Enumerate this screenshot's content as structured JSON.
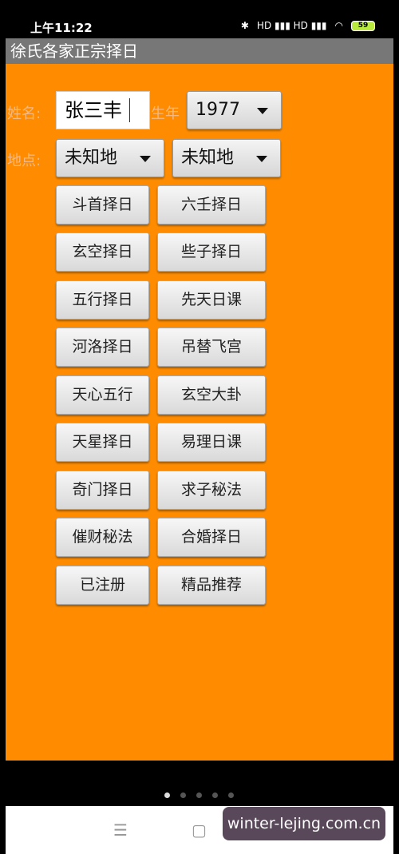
{
  "status_bar": {
    "time": "上午11:22",
    "signal": "HD ▮▮▮ HD ▮▮▮",
    "battery": "59"
  },
  "app": {
    "title": "徐氏各家正宗择日"
  },
  "form": {
    "name_label": "姓名:",
    "name_value": "张三丰",
    "year_label": "生年",
    "year_value": "1977",
    "place_label": "地点:",
    "place1": "未知地",
    "place2": "未知地"
  },
  "buttons": [
    "斗首择日",
    "六壬择日",
    "玄空择日",
    "些子择日",
    "五行择日",
    "先天日课",
    "河洛择日",
    "吊替飞宫",
    "天心五行",
    "玄空大卦",
    "天星择日",
    "易理日课",
    "奇门择日",
    "求子秘法",
    "催财秘法",
    "合婚择日",
    "已注册",
    "精品推荐"
  ],
  "nav": {
    "menu_icon": "☰",
    "home_icon": "▢"
  },
  "watermark": "winter-lejing.com.cn"
}
